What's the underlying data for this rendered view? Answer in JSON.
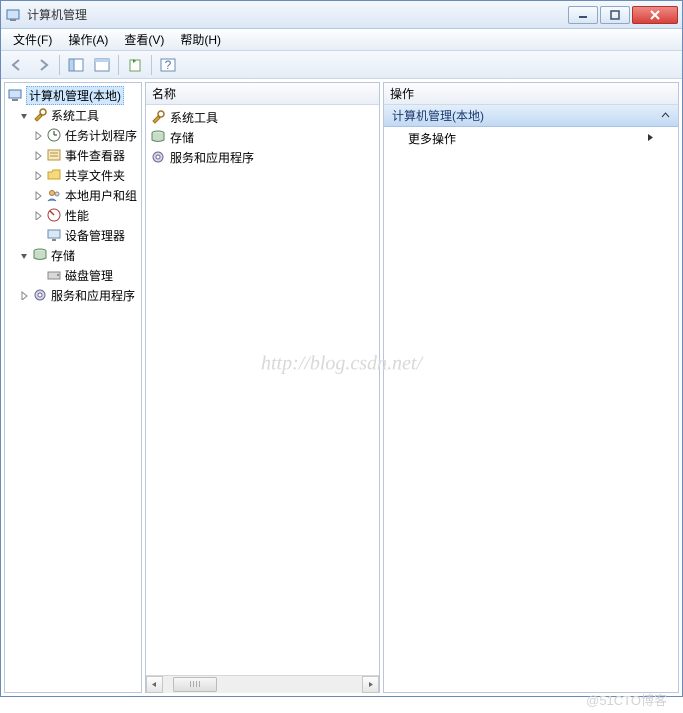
{
  "window": {
    "title": "计算机管理"
  },
  "menu": {
    "file": "文件(F)",
    "action": "操作(A)",
    "view": "查看(V)",
    "help": "帮助(H)"
  },
  "tree": {
    "root": "计算机管理(本地)",
    "sys_tools": "系统工具",
    "task_sched": "任务计划程序",
    "event_viewer": "事件查看器",
    "shared_folders": "共享文件夹",
    "local_users": "本地用户和组",
    "performance": "性能",
    "device_mgr": "设备管理器",
    "storage": "存储",
    "disk_mgmt": "磁盘管理",
    "services_apps": "服务和应用程序"
  },
  "list": {
    "header_name": "名称",
    "items": [
      "系统工具",
      "存储",
      "服务和应用程序"
    ]
  },
  "actions": {
    "header": "操作",
    "section": "计算机管理(本地)",
    "more": "更多操作"
  },
  "watermark": "http://blog.csdn.net/",
  "footmark": "@51CTO博客"
}
